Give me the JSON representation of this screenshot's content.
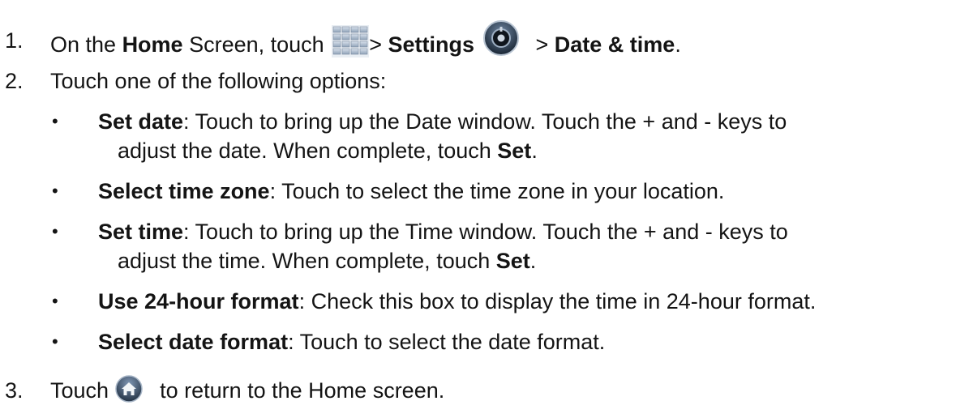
{
  "steps": [
    {
      "number": "1.",
      "parts": {
        "a": "On the ",
        "home": "Home",
        "b": " Screen, touch ",
        "c": "> ",
        "settings": "Settings",
        "d": " > ",
        "date_time": "Date & time",
        "e": "."
      },
      "icons": [
        "apps-grid-icon",
        "settings-icon"
      ]
    },
    {
      "number": "2.",
      "text": "Touch one of the following options:"
    },
    {
      "number": "3.",
      "parts": {
        "a": "Touch ",
        "b": " to return to the Home screen."
      },
      "icons": [
        "home-icon"
      ]
    }
  ],
  "options": [
    {
      "bullet": "•",
      "label": "Set date",
      "line1": ": Touch to bring up the Date window. Touch the + and - keys to",
      "line2a": "adjust the date. When complete, touch ",
      "line2b": "Set",
      "line2c": "."
    },
    {
      "bullet": "•",
      "label": "Select time zone",
      "line1": ": Touch to select the time zone in your location."
    },
    {
      "bullet": "•",
      "label": "Set time",
      "line1": ": Touch to bring up the Time window. Touch the + and - keys to",
      "line2a": "adjust the time. When complete, touch ",
      "line2b": "Set",
      "line2c": "."
    },
    {
      "bullet": "•",
      "label": "Use 24-hour format",
      "line1": ": Check this box to display the time in 24-hour format."
    },
    {
      "bullet": "•",
      "label": "Select date format",
      "line1": ": Touch to select the date format."
    }
  ],
  "colors": {
    "text": "#141414",
    "apps_icon": "#8fa2b8",
    "settings_icon": "#2f3e52",
    "home_icon": "#3a4c63"
  }
}
